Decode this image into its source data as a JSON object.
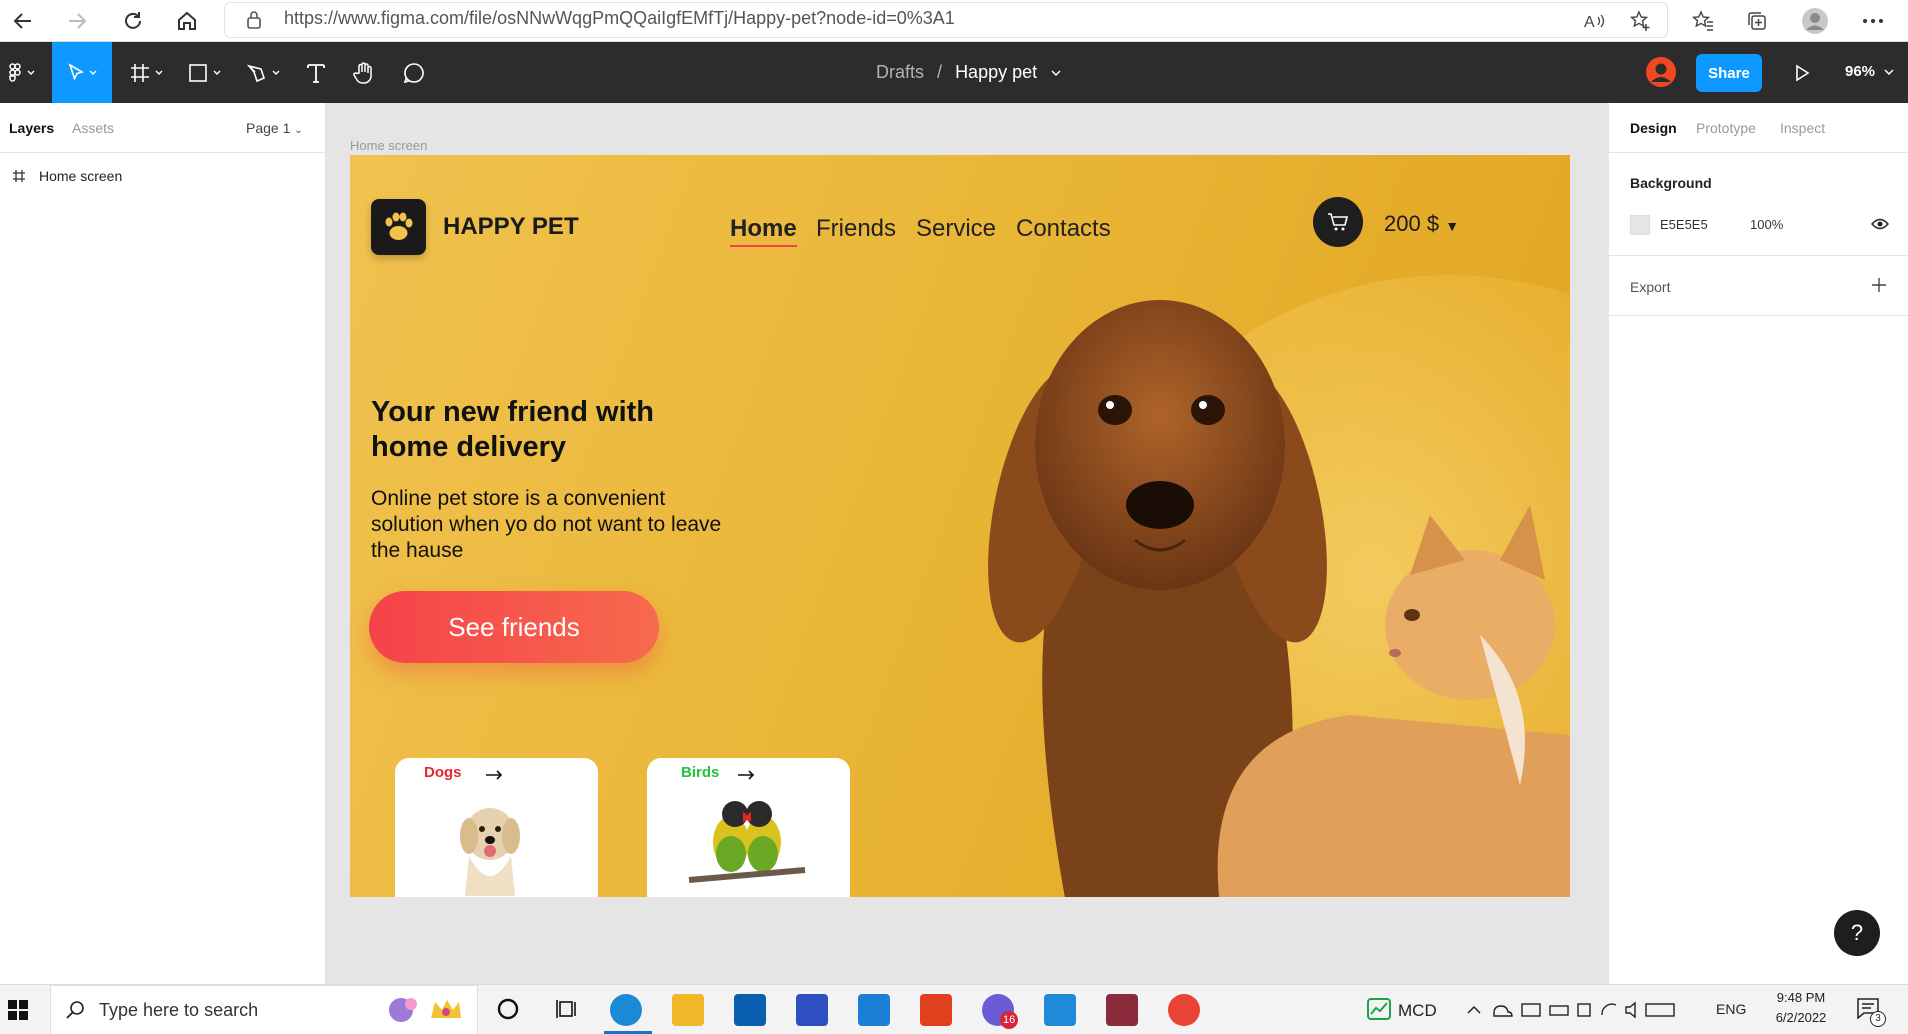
{
  "browser": {
    "url": "https://www.figma.com/file/osNNwWqgPmQQaiIgfEMfTj/Happy-pet?node-id=0%3A1"
  },
  "toolbar": {
    "breadcrumb_parent": "Drafts",
    "breadcrumb_separator": "/",
    "file_name": "Happy pet",
    "share_label": "Share",
    "zoom": "96%"
  },
  "left_panel": {
    "tabs": [
      "Layers",
      "Assets"
    ],
    "page": "Page 1",
    "layers": [
      {
        "icon": "frame-icon",
        "label": "Home screen"
      }
    ]
  },
  "right_panel": {
    "tabs": [
      "Design",
      "Prototype",
      "Inspect"
    ],
    "background_title": "Background",
    "background_color": "E5E5E5",
    "background_opacity": "100%",
    "export_label": "Export"
  },
  "canvas": {
    "frame_label": "Home screen",
    "design": {
      "brand": "HAPPY PET",
      "nav": [
        "Home",
        "Friends",
        "Service",
        "Contacts"
      ],
      "cart_amount": "200 $",
      "headline": "Your new friend with home delivery",
      "subtext": "Online pet store is a convenient solution when yo do not want to leave the hause",
      "cta_label": "See friends",
      "cards": [
        {
          "label": "Dogs",
          "color": "#e8262d"
        },
        {
          "label": "Birds",
          "color": "#25c13a"
        }
      ]
    }
  },
  "help_label": "?",
  "taskbar": {
    "search_placeholder": "Type here to search",
    "stock_label": "MCD",
    "language": "ENG",
    "time": "9:48 PM",
    "date": "6/2/2022",
    "teams_badge": "16",
    "notification_count": "3"
  },
  "colors": {
    "figma_blue": "#0d99ff",
    "toolbar_bg": "#2c2c2c",
    "frame_yellow": "#e9b637",
    "cta_red": "#f5424a"
  }
}
